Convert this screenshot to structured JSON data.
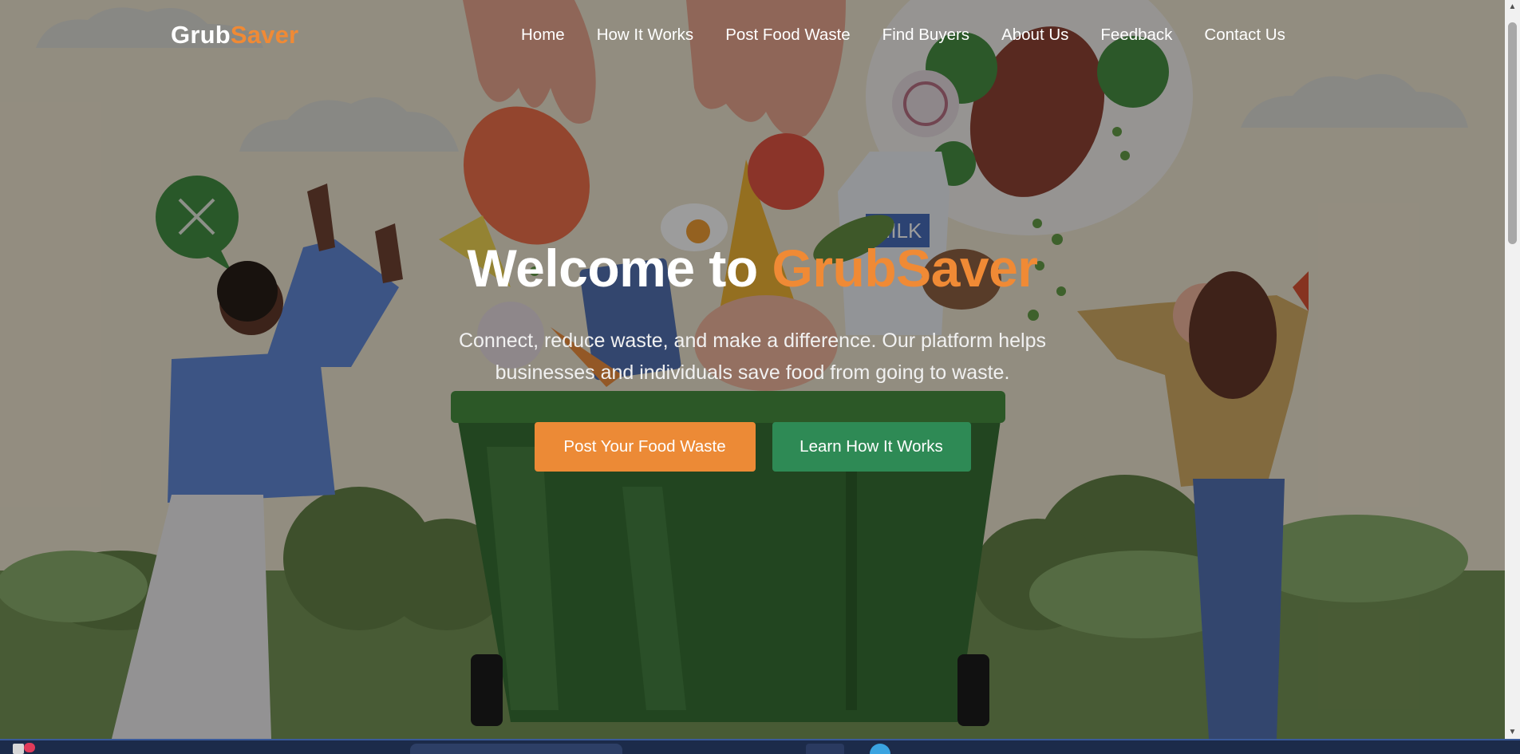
{
  "brand": {
    "part1": "Grub",
    "part2": "Saver"
  },
  "nav": {
    "links": [
      {
        "label": "Home"
      },
      {
        "label": "How It Works"
      },
      {
        "label": "Post Food Waste"
      },
      {
        "label": "Find Buyers"
      },
      {
        "label": "About Us"
      },
      {
        "label": "Feedback"
      },
      {
        "label": "Contact Us"
      }
    ]
  },
  "hero": {
    "title_prefix": "Welcome to ",
    "title_accent": "GrubSaver",
    "subtitle": "Connect, reduce waste, and make a difference. Our platform helps businesses and individuals save food from going to waste.",
    "primary_button": "Post Your Food Waste",
    "secondary_button": "Learn How It Works"
  },
  "illustration": {
    "milk_label": "MILK"
  },
  "colors": {
    "accent": "#f08a35",
    "primary_button": "#ec8a36",
    "secondary_button": "#2e8a55",
    "overlay": "rgba(20,20,18,0.42)"
  },
  "icons": [
    "close-icon",
    "chevron-up-icon",
    "chevron-down-icon"
  ]
}
